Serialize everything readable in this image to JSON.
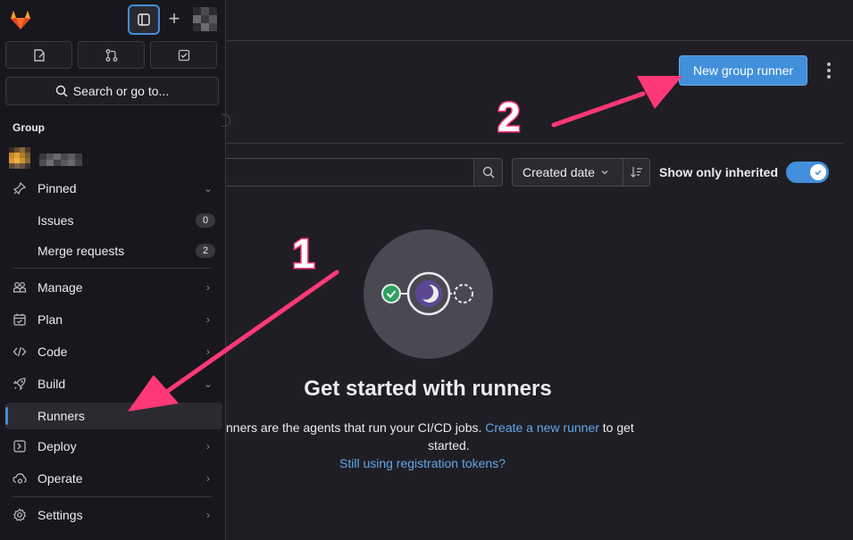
{
  "sidebar": {
    "search_label": "Search or go to...",
    "section_title": "Group",
    "items": [
      {
        "label": "Pinned"
      },
      {
        "label": "Issues",
        "count": "0"
      },
      {
        "label": "Merge requests",
        "count": "2"
      },
      {
        "label": "Manage"
      },
      {
        "label": "Plan"
      },
      {
        "label": "Code"
      },
      {
        "label": "Build"
      },
      {
        "label": "Runners"
      },
      {
        "label": "Deploy"
      },
      {
        "label": "Operate"
      },
      {
        "label": "Settings"
      }
    ]
  },
  "header": {
    "new_runner_label": "New group runner"
  },
  "filters": {
    "sort_label": "Created date",
    "toggle_label": "Show only inherited",
    "toggle_on": true
  },
  "empty_state": {
    "title": "Get started with runners",
    "desc_prefix": "nners are the agents that run your CI/CD jobs. ",
    "create_link": "Create a new runner",
    "desc_suffix": " to get",
    "desc_line2": "started.",
    "reg_link": "Still using registration tokens?"
  },
  "annotations": {
    "step1": "1",
    "step2": "2"
  },
  "colors": {
    "accent": "#428fdc",
    "annotation": "#ff3877",
    "success": "#2da160"
  }
}
